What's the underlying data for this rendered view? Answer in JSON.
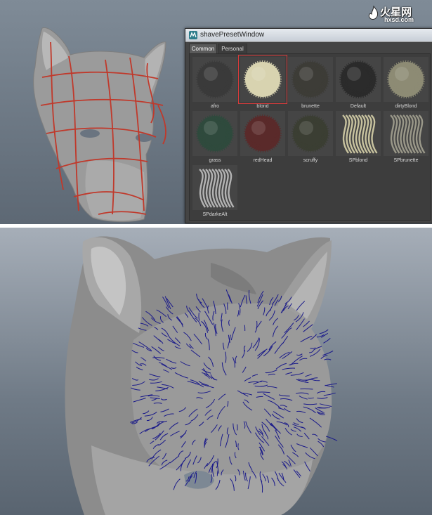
{
  "watermark": {
    "logo_text": "火星网",
    "url": "hxsd.com"
  },
  "preset_window": {
    "title": "shavePresetWindow",
    "tabs": [
      {
        "label": "Common",
        "active": true
      },
      {
        "label": "Personal",
        "active": false
      }
    ],
    "selected_preset": "blond",
    "presets": [
      {
        "label": "afro",
        "style": "ball",
        "color": "#3a3a3a"
      },
      {
        "label": "blond",
        "style": "ball",
        "color": "#d8d3b0"
      },
      {
        "label": "brunette",
        "style": "ball",
        "color": "#3d3c37"
      },
      {
        "label": "Default",
        "style": "ball",
        "color": "#2b2b2b"
      },
      {
        "label": "dirtyBlond",
        "style": "ball",
        "color": "#8d8b74"
      },
      {
        "label": "grass",
        "style": "ball",
        "color": "#2f4a3d"
      },
      {
        "label": "redHead",
        "style": "ball",
        "color": "#5a2a2a"
      },
      {
        "label": "scruffy",
        "style": "ball",
        "color": "#3b3e33"
      },
      {
        "label": "SPblond",
        "style": "strands",
        "color": "#d7d1a9"
      },
      {
        "label": "SPbrunette",
        "style": "strands",
        "color": "#a4a291"
      },
      {
        "label": "SPdarkeAlt",
        "style": "strands",
        "color": "#bfbfbf"
      }
    ]
  },
  "colors": {
    "viewport_bg": "#6f7a86",
    "model_gray": "#9a9a9a",
    "guide_lines": "#c0392b",
    "hair_guides": "#1a1a8a",
    "selection": "#d93a3a"
  }
}
